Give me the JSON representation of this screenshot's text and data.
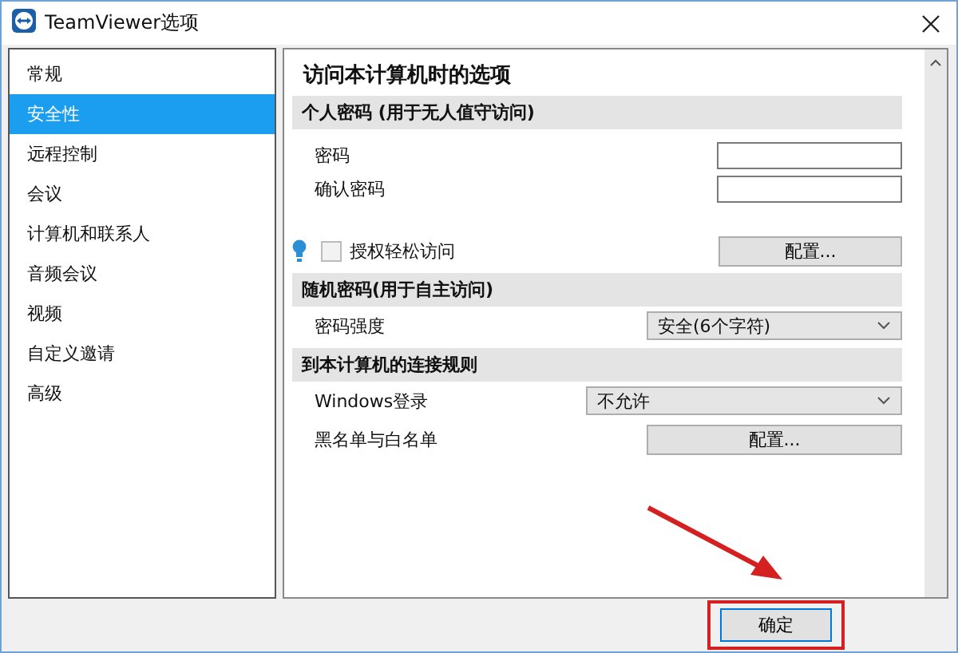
{
  "window": {
    "title": "TeamViewer选项"
  },
  "sidebar": {
    "items": [
      {
        "label": "常规",
        "selected": false
      },
      {
        "label": "安全性",
        "selected": true
      },
      {
        "label": "远程控制",
        "selected": false
      },
      {
        "label": "会议",
        "selected": false
      },
      {
        "label": "计算机和联系人",
        "selected": false
      },
      {
        "label": "音频会议",
        "selected": false
      },
      {
        "label": "视频",
        "selected": false
      },
      {
        "label": "自定义邀请",
        "selected": false
      },
      {
        "label": "高级",
        "selected": false
      }
    ]
  },
  "content": {
    "title": "访问本计算机时的选项",
    "sections": [
      {
        "heading": "个人密码 (用于无人值守访问)",
        "rows": [
          {
            "kind": "input",
            "label": "密码"
          },
          {
            "kind": "input",
            "label": "确认密码"
          },
          {
            "kind": "checkbox",
            "label": "授权轻松访问",
            "checked": false,
            "disabled": true,
            "button": "配置..."
          }
        ]
      },
      {
        "heading": "随机密码(用于自主访问)",
        "rows": [
          {
            "kind": "select",
            "label": "密码强度",
            "value": "安全(6个字符)"
          }
        ]
      },
      {
        "heading": "到本计算机的连接规则",
        "rows": [
          {
            "kind": "select",
            "label": "Windows登录",
            "value": "不允许",
            "wide": true
          },
          {
            "kind": "button",
            "label": "黑名单与白名单",
            "button": "配置..."
          }
        ]
      }
    ]
  },
  "buttons": [
    {
      "label": "确定",
      "highlighted": true
    }
  ]
}
